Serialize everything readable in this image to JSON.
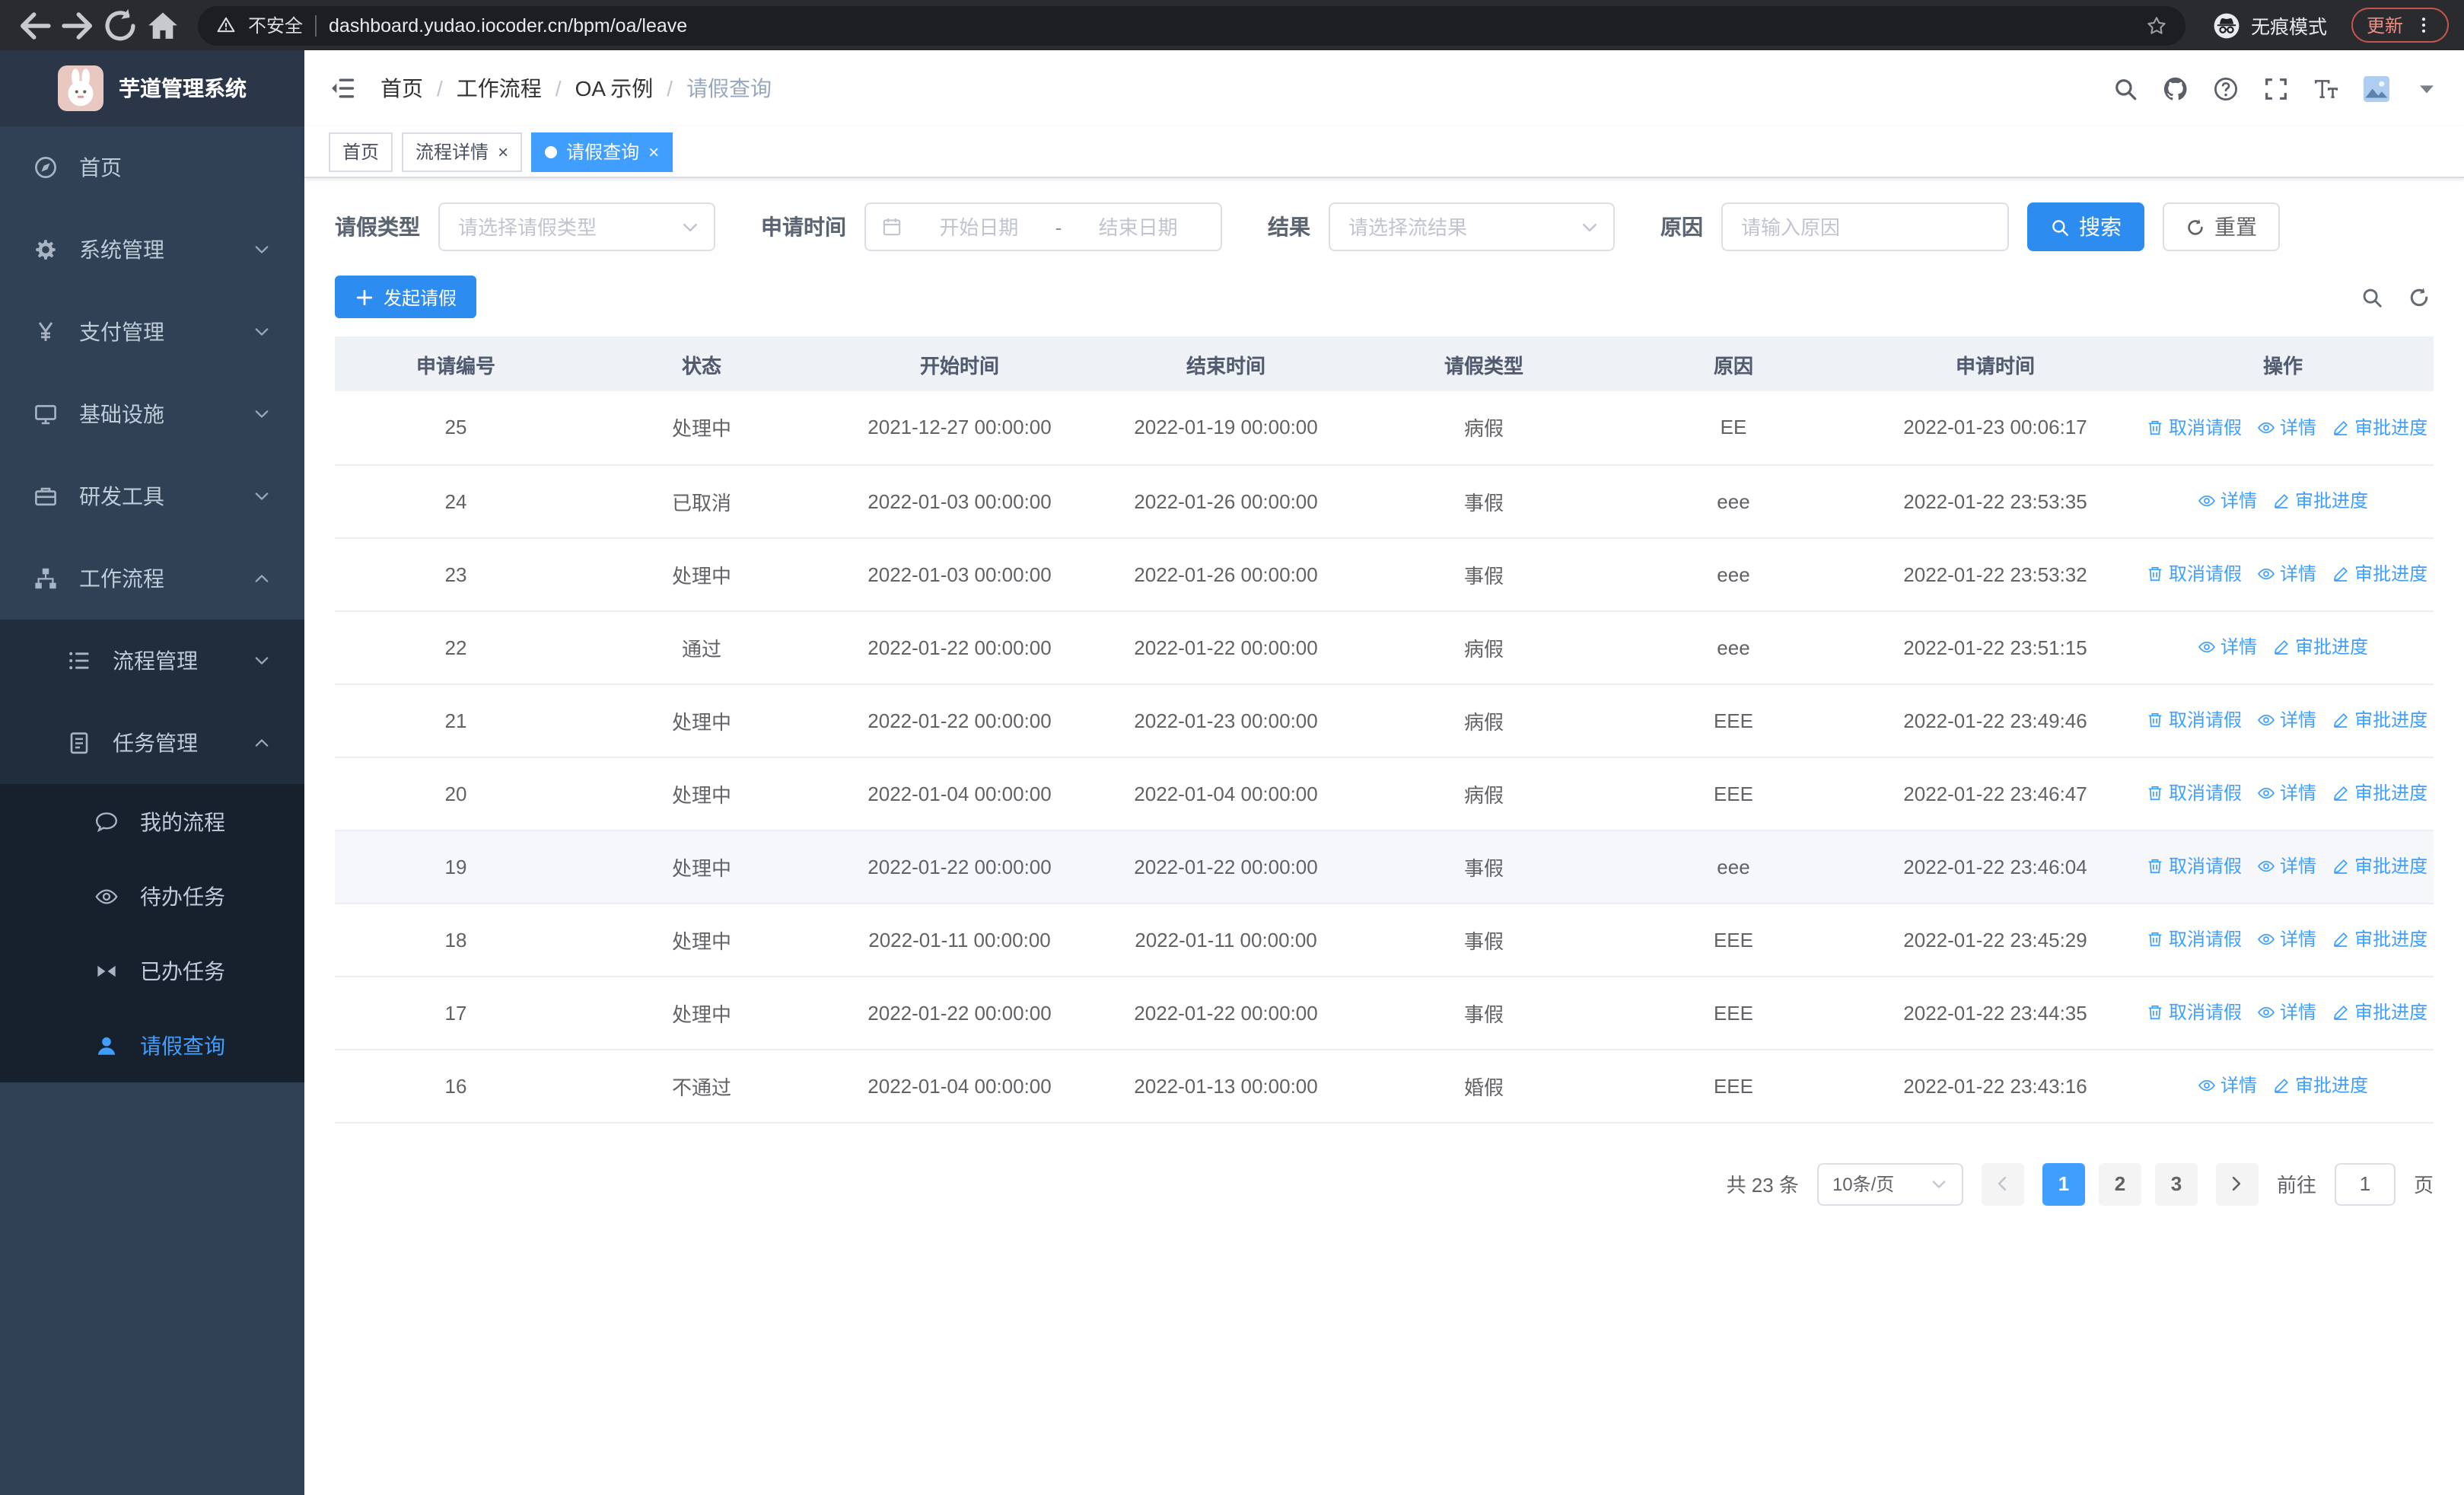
{
  "browser": {
    "security_label": "不安全",
    "url": "dashboard.yudao.iocoder.cn/bpm/oa/leave",
    "incognito_label": "无痕模式",
    "update_label": "更新"
  },
  "app_title": "芋道管理系统",
  "sidebar": {
    "items": [
      {
        "name": "home",
        "label": "首页",
        "icon": "dashboard-icon",
        "level": 1
      },
      {
        "name": "system-management",
        "label": "系统管理",
        "icon": "gear-icon",
        "level": 1,
        "chevron": "down"
      },
      {
        "name": "payment-management",
        "label": "支付管理",
        "icon": "yen-icon",
        "level": 1,
        "chevron": "down"
      },
      {
        "name": "infrastructure",
        "label": "基础设施",
        "icon": "monitor-icon",
        "level": 1,
        "chevron": "down"
      },
      {
        "name": "dev-tools",
        "label": "研发工具",
        "icon": "toolbox-icon",
        "level": 1,
        "chevron": "down"
      },
      {
        "name": "workflow",
        "label": "工作流程",
        "icon": "workflow-icon",
        "level": 1,
        "chevron": "up"
      },
      {
        "name": "process-management",
        "label": "流程管理",
        "icon": "list-icon",
        "level": 2,
        "chevron": "down"
      },
      {
        "name": "task-management",
        "label": "任务管理",
        "icon": "tasks-icon",
        "level": 2,
        "chevron": "up"
      },
      {
        "name": "my-process",
        "label": "我的流程",
        "icon": "chat-icon",
        "level": 3
      },
      {
        "name": "todo-tasks",
        "label": "待办任务",
        "icon": "eye-icon",
        "level": 3
      },
      {
        "name": "done-tasks",
        "label": "已办任务",
        "icon": "done-icon",
        "level": 3
      },
      {
        "name": "leave-query",
        "label": "请假查询",
        "icon": "user-icon",
        "level": 3,
        "active": true
      }
    ]
  },
  "breadcrumb": [
    "首页",
    "工作流程",
    "OA 示例",
    "请假查询"
  ],
  "tabs": [
    {
      "name": "home",
      "label": "首页",
      "closable": false,
      "active": false
    },
    {
      "name": "process-detail",
      "label": "流程详情",
      "closable": true,
      "active": false
    },
    {
      "name": "leave-query",
      "label": "请假查询",
      "closable": true,
      "active": true
    }
  ],
  "filters": {
    "leave_type_label": "请假类型",
    "leave_type_placeholder": "请选择请假类型",
    "apply_time_label": "申请时间",
    "start_placeholder": "开始日期",
    "range_separator": "-",
    "end_placeholder": "结束日期",
    "result_label": "结果",
    "result_placeholder": "请选择流结果",
    "reason_label": "原因",
    "reason_placeholder": "请输入原因",
    "search_label": "搜索",
    "reset_label": "重置"
  },
  "toolbar": {
    "create_label": "发起请假"
  },
  "table": {
    "columns": [
      "申请编号",
      "状态",
      "开始时间",
      "结束时间",
      "请假类型",
      "原因",
      "申请时间",
      "操作"
    ],
    "action_labels": {
      "cancel": "取消请假",
      "detail": "详情",
      "progress": "审批进度"
    },
    "rows": [
      {
        "id": "25",
        "status": "处理中",
        "start": "2021-12-27 00:00:00",
        "end": "2022-01-19 00:00:00",
        "type": "病假",
        "reason": "EE",
        "applied": "2022-01-23 00:06:17",
        "actions": [
          "cancel",
          "detail",
          "progress"
        ]
      },
      {
        "id": "24",
        "status": "已取消",
        "start": "2022-01-03 00:00:00",
        "end": "2022-01-26 00:00:00",
        "type": "事假",
        "reason": "eee",
        "applied": "2022-01-22 23:53:35",
        "actions": [
          "detail",
          "progress"
        ]
      },
      {
        "id": "23",
        "status": "处理中",
        "start": "2022-01-03 00:00:00",
        "end": "2022-01-26 00:00:00",
        "type": "事假",
        "reason": "eee",
        "applied": "2022-01-22 23:53:32",
        "actions": [
          "cancel",
          "detail",
          "progress"
        ]
      },
      {
        "id": "22",
        "status": "通过",
        "start": "2022-01-22 00:00:00",
        "end": "2022-01-22 00:00:00",
        "type": "病假",
        "reason": "eee",
        "applied": "2022-01-22 23:51:15",
        "actions": [
          "detail",
          "progress"
        ]
      },
      {
        "id": "21",
        "status": "处理中",
        "start": "2022-01-22 00:00:00",
        "end": "2022-01-23 00:00:00",
        "type": "病假",
        "reason": "EEE",
        "applied": "2022-01-22 23:49:46",
        "actions": [
          "cancel",
          "detail",
          "progress"
        ]
      },
      {
        "id": "20",
        "status": "处理中",
        "start": "2022-01-04 00:00:00",
        "end": "2022-01-04 00:00:00",
        "type": "病假",
        "reason": "EEE",
        "applied": "2022-01-22 23:46:47",
        "actions": [
          "cancel",
          "detail",
          "progress"
        ]
      },
      {
        "id": "19",
        "status": "处理中",
        "start": "2022-01-22 00:00:00",
        "end": "2022-01-22 00:00:00",
        "type": "事假",
        "reason": "eee",
        "applied": "2022-01-22 23:46:04",
        "actions": [
          "cancel",
          "detail",
          "progress"
        ],
        "hover": true
      },
      {
        "id": "18",
        "status": "处理中",
        "start": "2022-01-11 00:00:00",
        "end": "2022-01-11 00:00:00",
        "type": "事假",
        "reason": "EEE",
        "applied": "2022-01-22 23:45:29",
        "actions": [
          "cancel",
          "detail",
          "progress"
        ]
      },
      {
        "id": "17",
        "status": "处理中",
        "start": "2022-01-22 00:00:00",
        "end": "2022-01-22 00:00:00",
        "type": "事假",
        "reason": "EEE",
        "applied": "2022-01-22 23:44:35",
        "actions": [
          "cancel",
          "detail",
          "progress"
        ]
      },
      {
        "id": "16",
        "status": "不通过",
        "start": "2022-01-04 00:00:00",
        "end": "2022-01-13 00:00:00",
        "type": "婚假",
        "reason": "EEE",
        "applied": "2022-01-22 23:43:16",
        "actions": [
          "detail",
          "progress"
        ]
      }
    ]
  },
  "pagination": {
    "total_label": "共 23 条",
    "page_size_label": "10条/页",
    "pages": [
      "1",
      "2",
      "3"
    ],
    "active_page": "1",
    "goto_label": "前往",
    "goto_value": "1",
    "page_unit": "页"
  },
  "colors": {
    "accent": "#409eff",
    "button": "#2d8cf0",
    "sidebar_bg": "#304156",
    "submenu_bg": "#1f2d3d",
    "submenu_deep_bg": "#17212e"
  }
}
